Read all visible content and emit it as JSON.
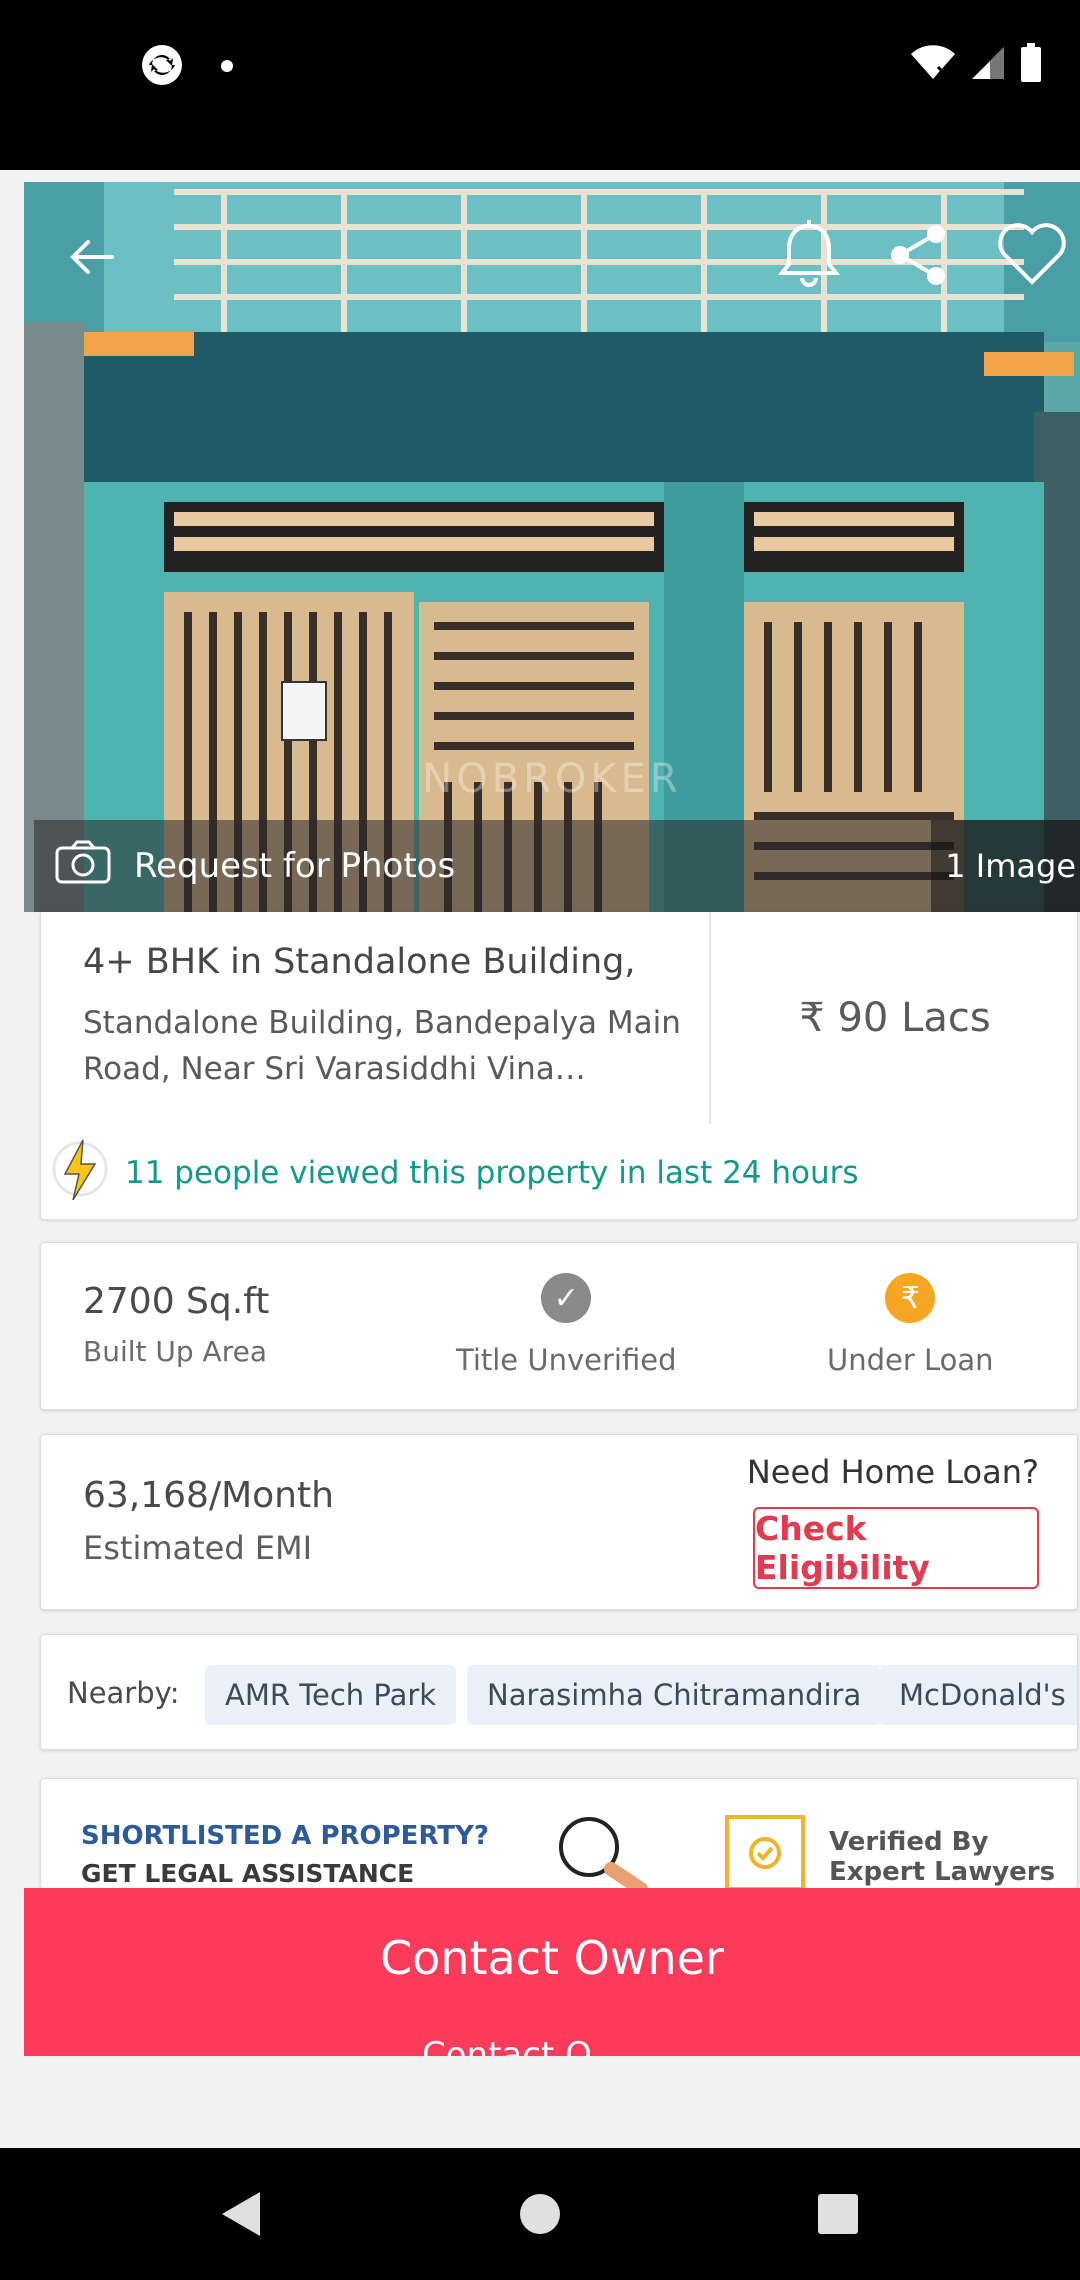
{
  "status_bar": {
    "left_icons": [
      "sync-icon",
      "notification-dot-icon"
    ],
    "right_icons": [
      "wifi-icon",
      "signal-icon",
      "battery-icon"
    ]
  },
  "hero": {
    "icons": [
      "back-arrow-icon",
      "bell-icon",
      "share-icon",
      "heart-icon"
    ],
    "watermark": "NOBROKER",
    "request_photos_label": "Request for Photos",
    "image_count": "1 Image"
  },
  "listing": {
    "title": "4+ BHK in Standalone Building,",
    "address": "Standalone Building, Bandepalya Main Road, Near Sri Varasiddhi Vina…",
    "price": "₹ 90 Lacs",
    "views_text": "11 people viewed this property in last 24 hours"
  },
  "details": {
    "area_value": "2700 Sq.ft",
    "area_label": "Built Up Area",
    "title_status": "Title Unverified",
    "loan_status": "Under Loan",
    "check_icon_color": "#8a8a8a",
    "rupee_icon_color": "#f5a623",
    "rupee_symbol": "₹",
    "check_symbol": "✓"
  },
  "emi": {
    "amount": "63,168/Month",
    "label": "Estimated EMI",
    "question": "Need Home Loan?",
    "button": "Check Eligibility"
  },
  "nearby": {
    "label": "Nearby:",
    "places": [
      "AMR Tech Park",
      "Narasimha Chitramandira",
      "McDonald's"
    ]
  },
  "legal": {
    "line1": "SHORTLISTED A PROPERTY?",
    "line2": "GET LEGAL ASSISTANCE",
    "verified_line1": "Verified By",
    "verified_line2": "Expert Lawyers"
  },
  "contact": {
    "button": "Contact Owner",
    "peek_text": "Contact O"
  },
  "nav_bar": {
    "buttons": [
      "back-nav-icon",
      "home-nav-icon",
      "recents-nav-icon"
    ]
  },
  "colors": {
    "accent": "#fc3a59",
    "teal_text": "#0f9a8a",
    "link_blue": "#2c5a9a"
  }
}
